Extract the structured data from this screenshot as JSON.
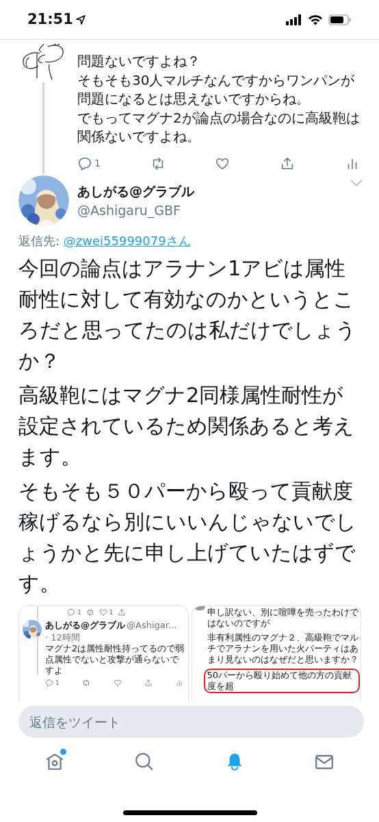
{
  "status_bar": {
    "time": "21:51"
  },
  "parent_tweet": {
    "lines": [
      "問題ないですよね？",
      "そもそも30人マルチなんですからワンパンが問題になるとは思えないですからね。",
      "でもってマグナ2が論点の場合なのに高級鞄は関係ないですよね。"
    ],
    "actions": [
      {
        "kind": "reply",
        "count": "1"
      },
      {
        "kind": "retweet"
      },
      {
        "kind": "like"
      },
      {
        "kind": "share"
      },
      {
        "kind": "analytics"
      }
    ]
  },
  "tweet": {
    "display_name": "あしがる@グラブル",
    "handle": "@Ashigaru_GBF",
    "reply_to_label": "返信先:",
    "reply_to": "@zwei55999079さん",
    "paragraphs": [
      "今回の論点はアラナン1アビは属性耐性に対して有効なのかというところだと思ってたのは私だけでしょうか？",
      "高級鞄にはマグナ2同様属性耐性が設定されているため関係あると考えます。",
      "そもそも５０パーから殴って貢献度稼げるなら別にいいんじゃないでしょうかと先に申し上げていたはずです。"
    ]
  },
  "attachments": [
    {
      "kind": "thread",
      "top_actions": [
        {
          "kind": "reply",
          "count": "1"
        },
        {
          "kind": "retweet"
        },
        {
          "kind": "like",
          "count": "1"
        },
        {
          "kind": "share"
        }
      ],
      "tweet": {
        "display_name": "あしがる@グラブル",
        "handle": "@Ashigar...",
        "time": "· 12時間",
        "text": "マグナ2は属性耐性持ってるので弱点属性でないと攻撃が通らないですよ",
        "actions": [
          {
            "kind": "reply",
            "count": "1"
          },
          {
            "kind": "retweet"
          },
          {
            "kind": "like"
          },
          {
            "kind": "share"
          },
          {
            "kind": "analytics"
          }
        ]
      }
    },
    {
      "kind": "notes",
      "paragraphs": [
        "申し訳ない、別に喧嘩を売ったわけではないのですが",
        "非有利属性のマグナ２、高級鞄でマルチでアラナンを用いた火パーティはあまり見ないのはなぜだと思いますか？"
      ],
      "highlighted": "50パーから殴り始めて他の方の貢献度を超"
    }
  ],
  "reply_field": {
    "placeholder": "返信をツイート"
  },
  "tab_bar": [
    {
      "kind": "home",
      "selected": false,
      "badge": true
    },
    {
      "kind": "search",
      "selected": false
    },
    {
      "kind": "notifications",
      "selected": true
    },
    {
      "kind": "messages",
      "selected": false
    }
  ]
}
